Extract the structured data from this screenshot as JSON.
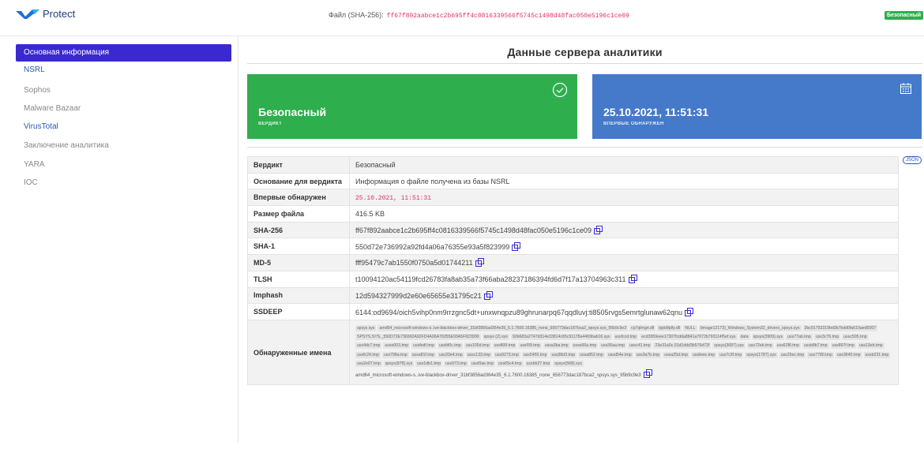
{
  "app": {
    "name": "Protect"
  },
  "header": {
    "file_label": "Файл (SHA-256):",
    "file_hash": "ff67f892aabce1c2b695ff4c0816339566f5745c1498d48fac050e5196c1ce09",
    "status_badge": "Безопасный"
  },
  "sidebar": {
    "items": [
      {
        "label": "Основная информация"
      },
      {
        "label": "NSRL"
      },
      {
        "label": "Sophos"
      },
      {
        "label": "Malware Bazaar"
      },
      {
        "label": "VirusTotal"
      },
      {
        "label": "Заключение аналитика"
      },
      {
        "label": "YARA"
      },
      {
        "label": "IOC"
      }
    ]
  },
  "main": {
    "title": "Данные сервера аналитики",
    "cards": [
      {
        "value": "Безопасный",
        "label": "вердикт",
        "icon": "check-circle-icon"
      },
      {
        "value": "25.10.2021, 11:51:31",
        "label": "впервые обнаружен",
        "icon": "calendar-icon"
      }
    ],
    "json_button": "JSON",
    "table": {
      "rows": [
        {
          "key": "Вердикт",
          "value": "Безопасный"
        },
        {
          "key": "Основание для вердикта",
          "value": "Информация о файле получена из базы NSRL"
        },
        {
          "key": "Впервые обнаружен",
          "value": "25.10.2021, 11:51:31"
        },
        {
          "key": "Размер файла",
          "value": "416.5 KB"
        },
        {
          "key": "SHA-256",
          "value": "ff67f892aabce1c2b695ff4c0816339566f5745c1498d48fac050e5196c1ce09"
        },
        {
          "key": "SHA-1",
          "value": "550d72e736992a92fd4a06a76355e93a5f823999"
        },
        {
          "key": "MD-5",
          "value": "fff95479c7ab1550f0750a5d01744211"
        },
        {
          "key": "TLSH",
          "value": "t10094120ac54119fcd26783fa8ab35a73f66aba28237186394fd6d7f17a13704963c311"
        },
        {
          "key": "Imphash",
          "value": "12d594327999d2e60e65655e31795c21"
        },
        {
          "key": "SSDEEP",
          "value": "6144:od9694/oich5vihp0nm9rrzgnc5dt+unxwnqpzu89ghrunarpq67qqdluvj:ti8505rvgs5emrtglunaw62qnu"
        }
      ],
      "names_key": "Обнаруженные имена",
      "names": [
        "spsys.sys",
        "amd64_microsoft-windows-s..ive-blackbox-driver_31bf3856ad364e35_6.1.7600.16385_none_656773dac187bca2_spsys.sys_95b9c9e3",
        "cp7qlmgri.dll",
        "lppidfp8y.dll",
        "NULL",
        "(Image12173)_Windows_System32_drivers_spsys.sys",
        "2bc91793319bd3b7bdd0fa610aed5007",
        "SPSYS.SYS._550D72E736992A92FD4A06A76355E93A5F823999",
        "spsys (2).sys",
        "92b683a2747d314e33814c65c91178a4469bab16.sys",
        "ussfccd.tmp",
        "ecd3959eee17307fcdda8841a7672b793114f5ef.sys",
        "data",
        "spsys(3909).sys",
        "uss77ab.tmp",
        "uss3c76.tmp",
        "ussc505.tmp",
        "uss4dc7.tmp",
        "usse003.tmp",
        "ussfedf.tmp",
        "ussfd0c.tmp",
        "uss105d.tmp",
        "ussf66f.tmp",
        "ussf39.tmp",
        "ussa3ba.tmp",
        "usse00a.tmp",
        "uss36aa.tmp",
        "ussc41.tmp",
        "23e31a0c.01d1ddd3b579d72f",
        "spsys(3687).sys",
        "uss72eb.tmp",
        "uss62f8.tmp",
        "ussb8b7.tmp",
        "uss897f.tmp",
        "uss13eb.tmp",
        "ussfc24.tmp",
        "uss798a.tmp",
        "ussa81f.tmp",
        "uss33e4.tmp",
        "ussc133.tmp",
        "uss9273.tmp",
        "uss5455.tmp",
        "uss38d3.tmp",
        "ussa852.tmp",
        "ussd54e.tmp",
        "uss3a7b.tmp",
        "ussa25d.tmp",
        "ussfeee.tmp",
        "uss7c3f.tmp",
        "spsys(1787).sys",
        "uss25ec.tmp",
        "uss7780.tmp",
        "uss3640.tmp",
        "ussb231.tmp",
        "uss2e07.tmp",
        "spsys(878).sys",
        "uss1db1.tmp",
        "uss973.tmp",
        "ussf0ae.tmp",
        "uss65c4.tmp",
        "ussbb27.tmp",
        "spsys(568).sys"
      ],
      "names_last": "amd64_microsoft-windows-s..ive-blackbox-driver_31bf3856ad364e35_6.1.7600.16385_none_656773dac187bca2_spsys.sys_95b9c9e3"
    }
  },
  "colors": {
    "primary": "#3a29d0",
    "safe_green": "#2fae4e",
    "info_blue": "#4579c9",
    "hash_red": "#e0306a"
  }
}
